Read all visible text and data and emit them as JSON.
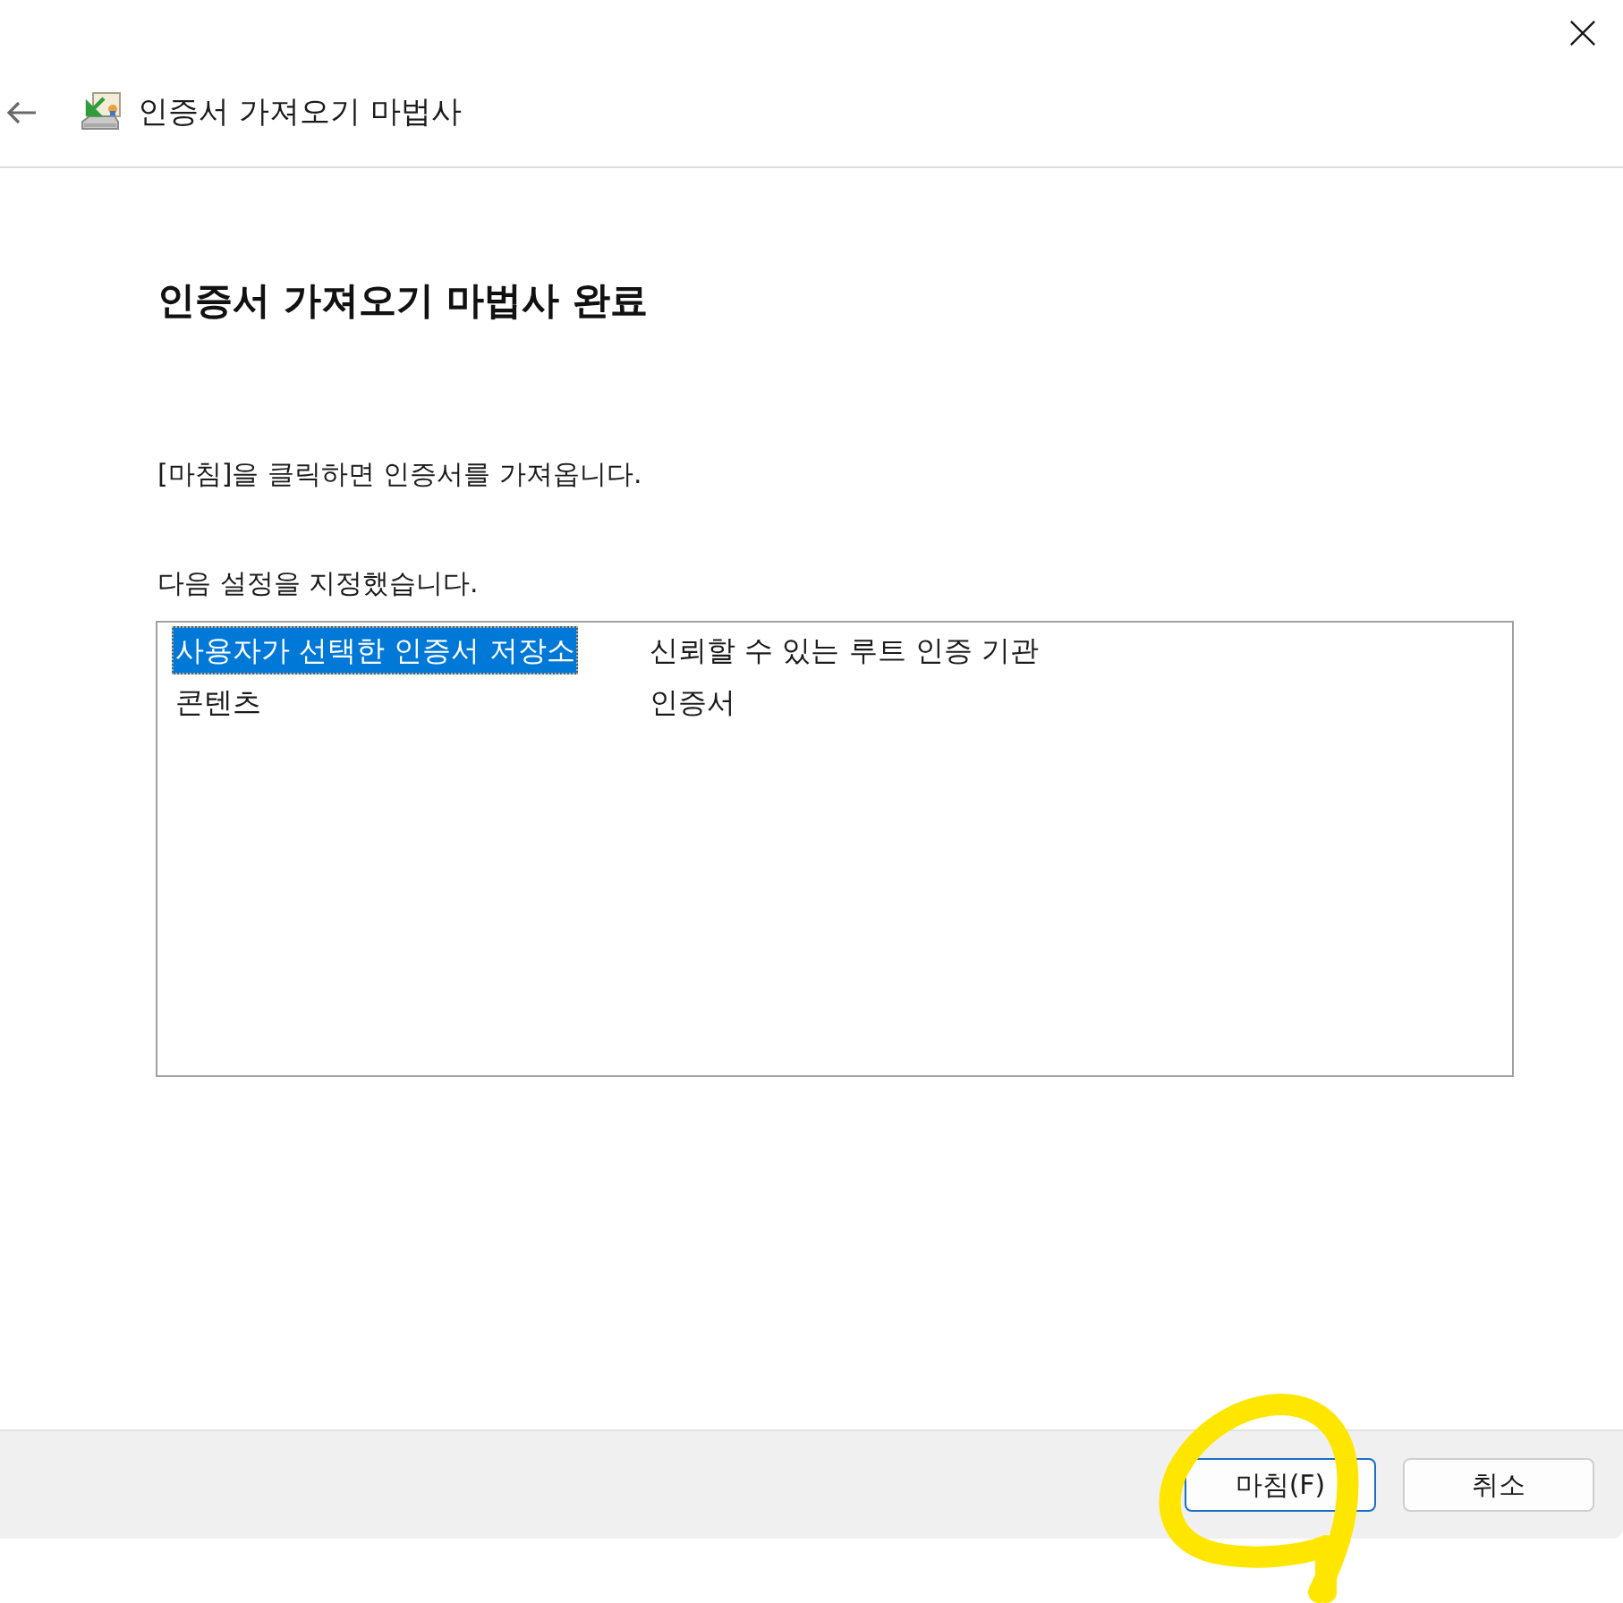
{
  "header": {
    "title": "인증서 가져오기 마법사"
  },
  "heading": "인증서 가져오기 마법사 완료",
  "instruction": "[마침]을 클릭하면 인증서를 가져옵니다.",
  "settings": {
    "label": "다음 설정을 지정했습니다.",
    "rows": [
      {
        "name": "사용자가 선택한 인증서 저장소",
        "value": "신뢰할 수 있는 루트 인증 기관",
        "selected": true
      },
      {
        "name": "콘텐츠",
        "value": "인증서",
        "selected": false
      }
    ]
  },
  "buttons": [
    {
      "label": "마침(F)",
      "default": true
    },
    {
      "label": "취소",
      "default": false
    }
  ]
}
